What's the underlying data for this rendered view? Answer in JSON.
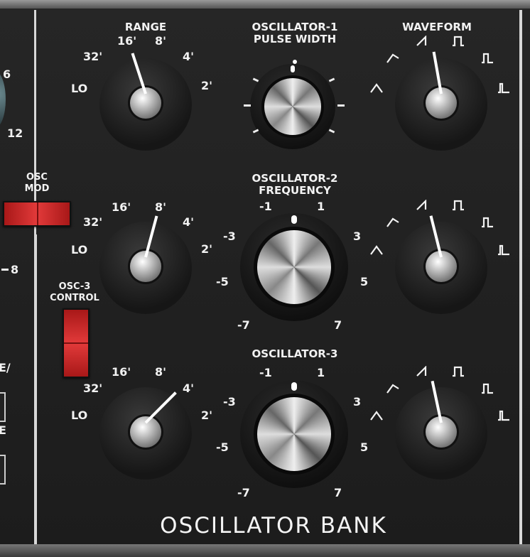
{
  "panel": {
    "title": "OSCILLATOR BANK"
  },
  "left_strip": {
    "label_6": "6",
    "label_12": "12",
    "label_8": "8",
    "label_e_slash": "E/",
    "label_e": "E"
  },
  "osc_mod": {
    "label_line1": "OSC",
    "label_line2": "MOD",
    "color": "#cc2222"
  },
  "osc3_control": {
    "label_line1": "OSC-3",
    "label_line2": "CONTROL",
    "color": "#cc2222"
  },
  "range": {
    "header": "RANGE",
    "labels": {
      "lo": "LO",
      "r32": "32'",
      "r16": "16'",
      "r8": "8'",
      "r4": "4'",
      "r2": "2'"
    },
    "osc1_value": "16'",
    "osc2_value": "8'",
    "osc3_value": "4'"
  },
  "pulse_width": {
    "header_line1": "OSCILLATOR-1",
    "header_line2": "PULSE WIDTH"
  },
  "osc2_freq": {
    "header_line1": "OSCILLATOR-2",
    "header_line2": "FREQUENCY"
  },
  "osc3_freq": {
    "header": "OSCILLATOR-3"
  },
  "freq_scale": {
    "m1": "-1",
    "p1": "1",
    "m3": "-3",
    "p3": "3",
    "m5": "-5",
    "p5": "5",
    "m7": "-7",
    "p7": "7",
    "zero": "0"
  },
  "waveform": {
    "header": "WAVEFORM",
    "options": [
      "triangle-icon",
      "triangle-saw-icon",
      "sawtooth-icon",
      "square-icon",
      "wide-pulse-icon",
      "narrow-pulse-icon"
    ],
    "osc1_value": "sawtooth-icon",
    "osc2_value": "sawtooth-icon",
    "osc3_value": "sawtooth-icon"
  }
}
